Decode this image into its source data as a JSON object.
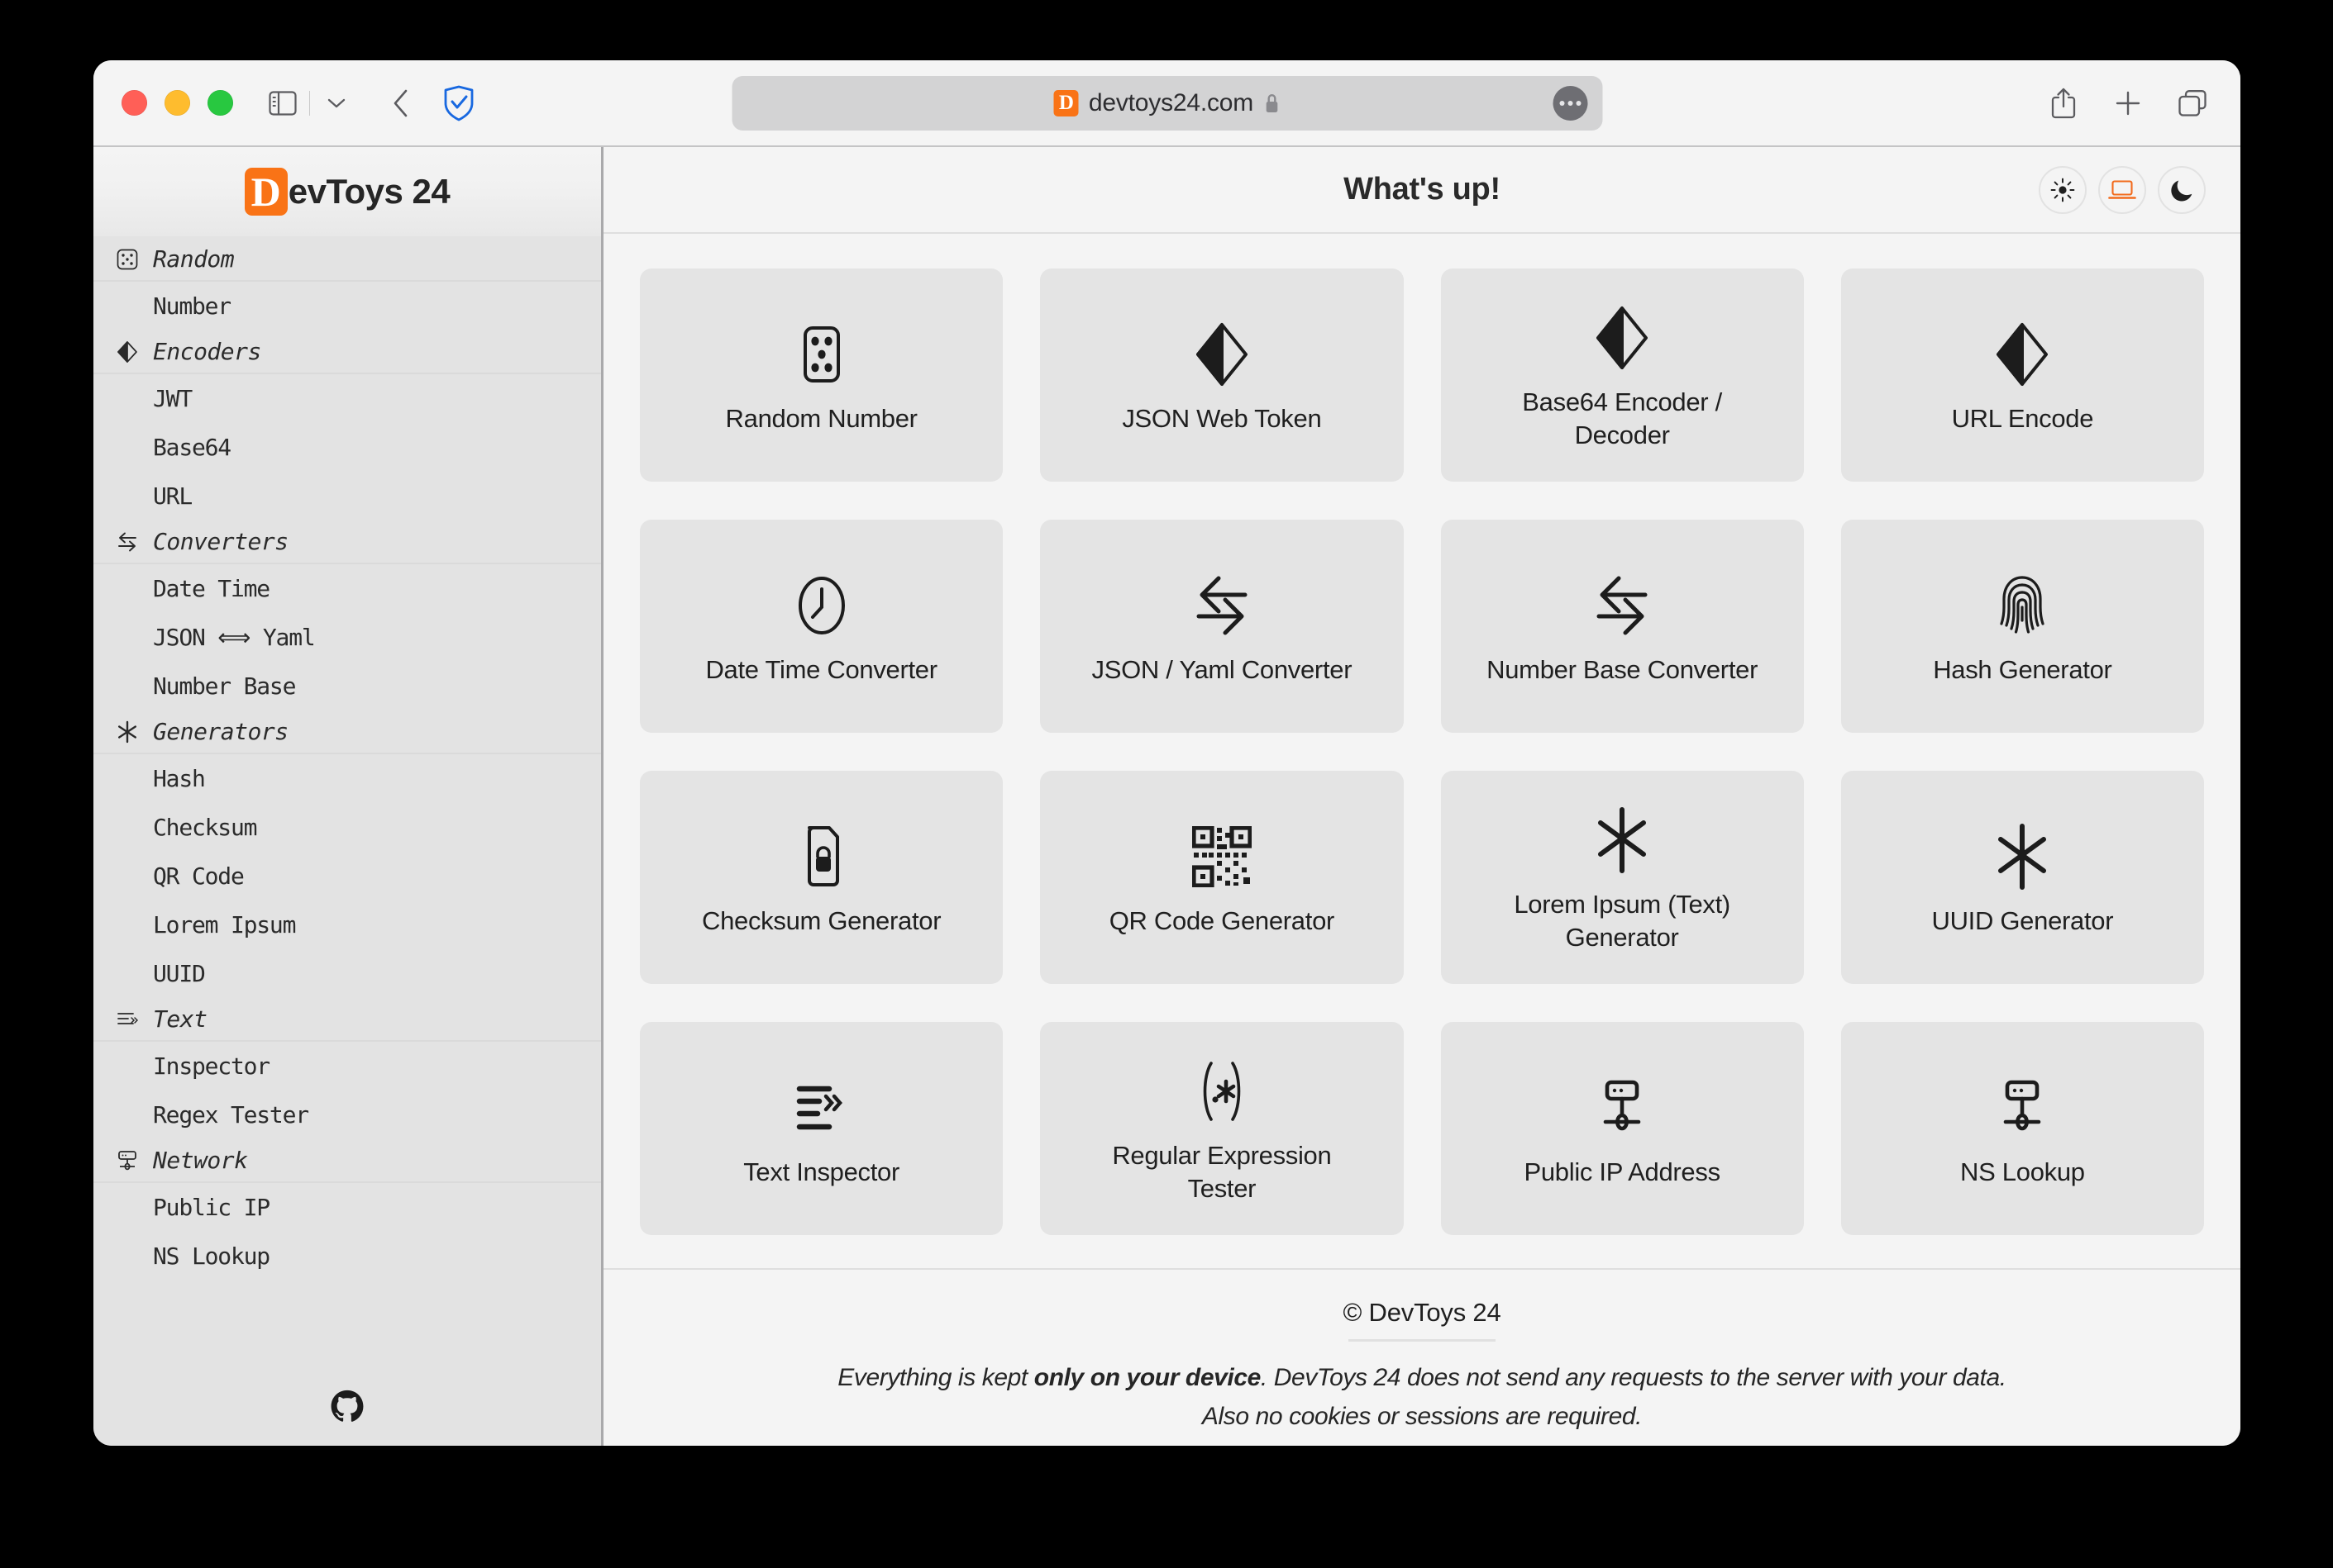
{
  "browser": {
    "traffic_lights": [
      "close",
      "minimize",
      "zoom"
    ],
    "sidebar_toggle": "sidebar-icon",
    "tab_overview_chevron": "chevron-down-icon",
    "back": "back-arrow-icon",
    "shield": "adguard-shield-icon",
    "url": {
      "favicon_letter": "D",
      "text": "devtoys24.com",
      "lock": "lock-icon",
      "more": "more-options-icon"
    },
    "actions": {
      "share": "share-icon",
      "new_tab": "plus-icon",
      "tabs": "tab-overview-icon"
    }
  },
  "sidebar": {
    "brand": {
      "mark": "D",
      "text": "evToys 24"
    },
    "groups": [
      {
        "label": "Random",
        "icon": "dice-icon",
        "items": [
          {
            "label": "Number"
          }
        ]
      },
      {
        "label": "Encoders",
        "icon": "diamond-half-icon",
        "items": [
          {
            "label": "JWT"
          },
          {
            "label": "Base64"
          },
          {
            "label": "URL"
          }
        ]
      },
      {
        "label": "Converters",
        "icon": "swap-arrows-icon",
        "items": [
          {
            "label": "Date Time"
          },
          {
            "label": "JSON ⟺ Yaml"
          },
          {
            "label": "Number Base"
          }
        ]
      },
      {
        "label": "Generators",
        "icon": "asterisk-icon",
        "items": [
          {
            "label": "Hash"
          },
          {
            "label": "Checksum"
          },
          {
            "label": "QR Code"
          },
          {
            "label": "Lorem Ipsum"
          },
          {
            "label": "UUID"
          }
        ]
      },
      {
        "label": "Text",
        "icon": "text-lines-icon",
        "items": [
          {
            "label": "Inspector"
          },
          {
            "label": "Regex Tester"
          }
        ]
      },
      {
        "label": "Network",
        "icon": "server-node-icon",
        "items": [
          {
            "label": "Public IP"
          },
          {
            "label": "NS Lookup"
          }
        ]
      }
    ],
    "github": "github-icon"
  },
  "content": {
    "title": "What's up!",
    "theme": {
      "light": "sun-icon",
      "system": "laptop-icon",
      "dark": "moon-icon",
      "active": "system"
    },
    "cards": [
      {
        "label": "Random Number",
        "icon": "dice-icon"
      },
      {
        "label": "JSON Web Token",
        "icon": "diamond-half-icon"
      },
      {
        "label": "Base64 Encoder / Decoder",
        "icon": "diamond-half-icon"
      },
      {
        "label": "URL Encode",
        "icon": "diamond-half-icon"
      },
      {
        "label": "Date Time Converter",
        "icon": "clock-icon"
      },
      {
        "label": "JSON / Yaml Converter",
        "icon": "swap-arrows-icon"
      },
      {
        "label": "Number Base Converter",
        "icon": "swap-arrows-icon"
      },
      {
        "label": "Hash Generator",
        "icon": "fingerprint-icon"
      },
      {
        "label": "Checksum Generator",
        "icon": "file-lock-icon"
      },
      {
        "label": "QR Code Generator",
        "icon": "qr-code-icon"
      },
      {
        "label": "Lorem Ipsum (Text) Generator",
        "icon": "asterisk-icon"
      },
      {
        "label": "UUID Generator",
        "icon": "asterisk-icon"
      },
      {
        "label": "Text Inspector",
        "icon": "text-lines-icon"
      },
      {
        "label": "Regular Expression Tester",
        "icon": "regex-icon"
      },
      {
        "label": "Public IP Address",
        "icon": "server-node-icon"
      },
      {
        "label": "NS Lookup",
        "icon": "server-node-icon"
      }
    ]
  },
  "footer": {
    "copyright": "© DevToys 24",
    "note_before": "Everything is kept ",
    "note_bold": "only on your device",
    "note_after": ". DevToys 24 does not send any requests to the server with your data.",
    "note_line2": "Also no cookies or sessions are required."
  },
  "colors": {
    "brand_orange": "#f97316",
    "accent_orange": "#f26b1d",
    "page_bg": "#f4f4f4",
    "card_bg": "#e4e4e4",
    "sidebar_bg": "#e3e3e3"
  }
}
